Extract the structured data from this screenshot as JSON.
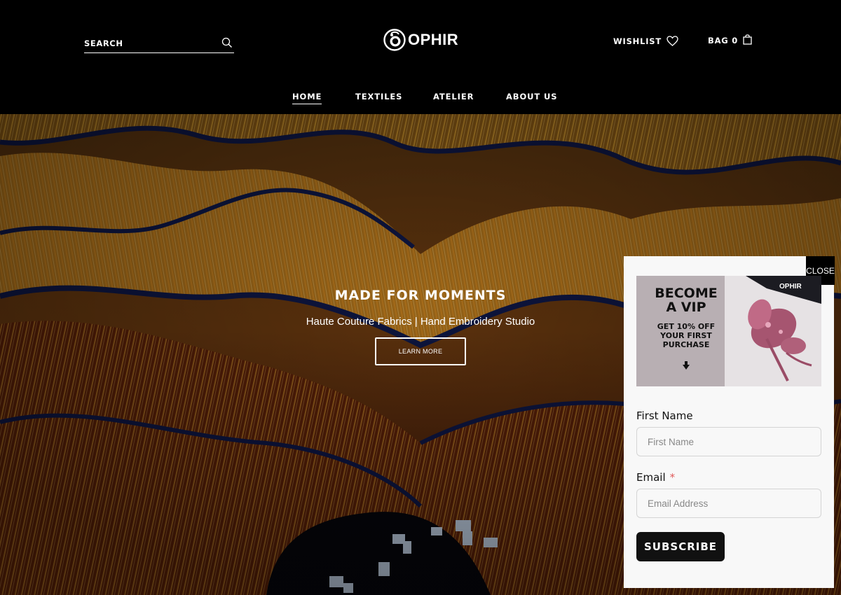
{
  "header": {
    "search": {
      "placeholder": "SEARCH"
    },
    "logo_text": "OPHIR",
    "wishlist_label": "WISHLIST",
    "bag_label": "BAG 0"
  },
  "nav": {
    "items": [
      {
        "label": "HOME",
        "active": true
      },
      {
        "label": "TEXTILES"
      },
      {
        "label": "ATELIER"
      },
      {
        "label": "ABOUT US"
      }
    ]
  },
  "hero": {
    "title": "MADE FOR MOMENTS",
    "subtitle": "Haute Couture Fabrics | Hand Embroidery Studio",
    "button_label": "LEARN MORE"
  },
  "popup": {
    "close_label": "CLOSE",
    "promo": {
      "headline_line1": "BECOME",
      "headline_line2": "A VIP",
      "offer_line1": "GET 10% OFF",
      "offer_line2": "YOUR FIRST",
      "offer_line3": "PURCHASE",
      "package_brand": "OPHIR"
    },
    "first_name": {
      "label": "First Name",
      "placeholder": "First Name"
    },
    "email": {
      "label": "Email",
      "required_mark": "*",
      "placeholder": "Email Address"
    },
    "subscribe_label": "SUBSCRIBE"
  },
  "colors": {
    "header_bg": "#000000",
    "popup_bg": "#f8f8f8",
    "promo_bg": "#b8afb3",
    "required": "#e05a5a",
    "hero_gold": "#c8861a",
    "hero_navy": "#101a4a"
  }
}
